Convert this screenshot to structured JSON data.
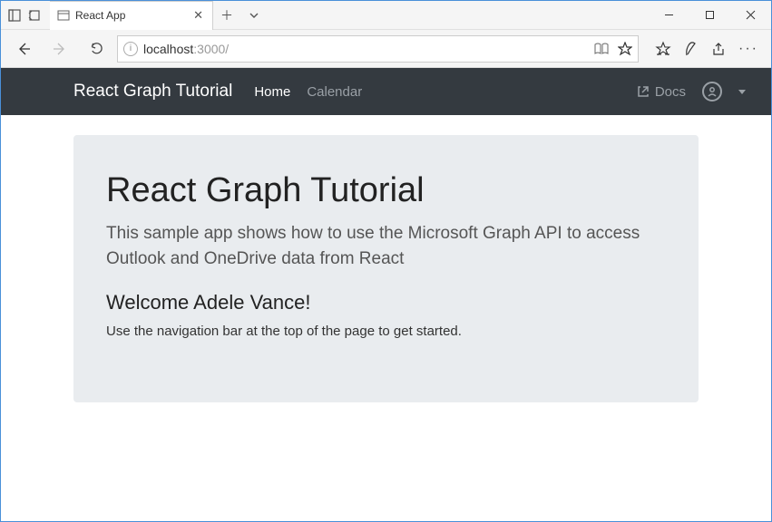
{
  "browser": {
    "tab_title": "React App",
    "url_host": "localhost",
    "url_port": ":3000/"
  },
  "navbar": {
    "brand": "React Graph Tutorial",
    "links": {
      "home": "Home",
      "calendar": "Calendar"
    },
    "docs": "Docs"
  },
  "jumbotron": {
    "title": "React Graph Tutorial",
    "lead": "This sample app shows how to use the Microsoft Graph API to access Outlook and OneDrive data from React",
    "welcome": "Welcome Adele Vance!",
    "hint": "Use the navigation bar at the top of the page to get started."
  }
}
